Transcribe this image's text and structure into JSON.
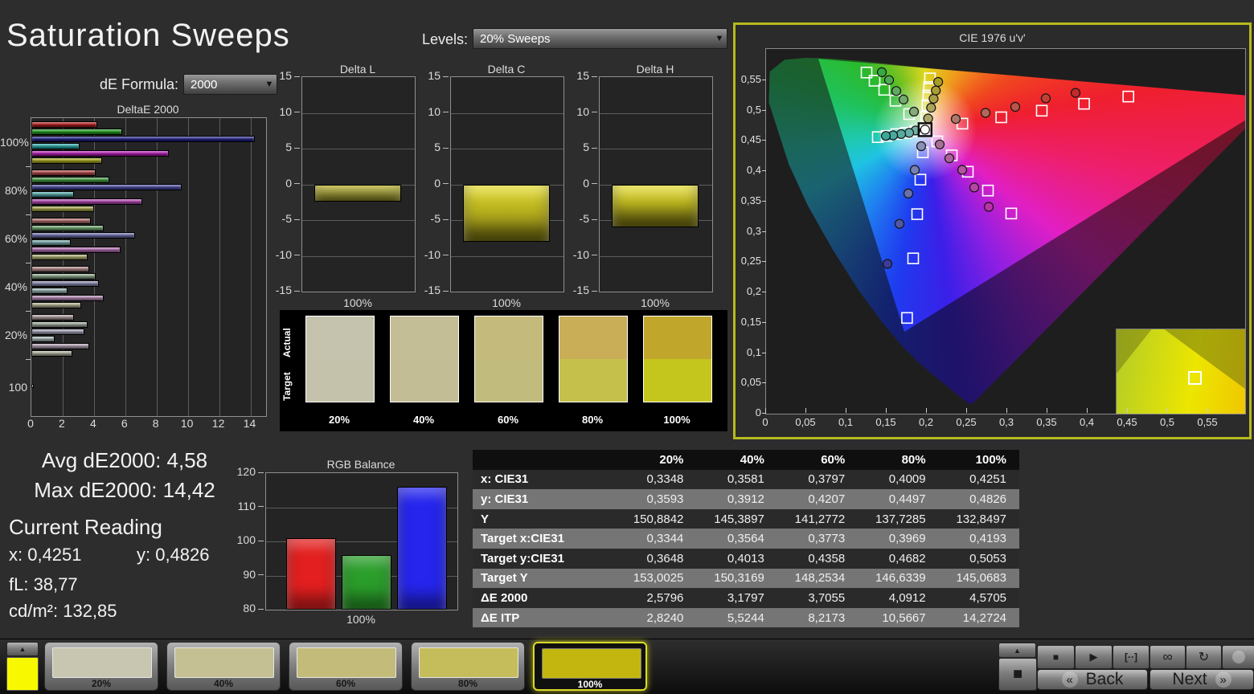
{
  "title": "Saturation Sweeps",
  "controls": {
    "de_formula_label": "dE Formula:",
    "de_formula_value": "2000",
    "levels_label": "Levels:",
    "levels_value": "20% Sweeps"
  },
  "readings": {
    "avg": "Avg dE2000: 4,58",
    "max": "Max dE2000: 14,42",
    "current_title": "Current Reading",
    "x": "x: 0,4251",
    "y": "y: 0,4826",
    "fl": "fL: 38,77",
    "cd": "cd/m²: 132,85"
  },
  "chart_data": [
    {
      "id": "deltae2000",
      "type": "bar",
      "orientation": "horizontal",
      "title": "DeltaE 2000",
      "xlim": [
        0,
        15
      ],
      "xticks": [
        0,
        2,
        4,
        6,
        8,
        10,
        12,
        14
      ],
      "groups": [
        {
          "label": "100%",
          "values": [
            4.2,
            5.8,
            14.3,
            3.1,
            8.8,
            4.5
          ]
        },
        {
          "label": "80%",
          "values": [
            4.1,
            5.0,
            9.6,
            2.7,
            7.1,
            4.0
          ]
        },
        {
          "label": "60%",
          "values": [
            3.8,
            4.6,
            6.6,
            2.5,
            5.7,
            3.6
          ]
        },
        {
          "label": "40%",
          "values": [
            3.7,
            4.1,
            4.3,
            2.3,
            4.6,
            3.2
          ]
        },
        {
          "label": "20%",
          "values": [
            2.7,
            3.6,
            3.4,
            1.5,
            3.7,
            2.6
          ]
        },
        {
          "label": "100",
          "values": [
            0.15
          ]
        }
      ],
      "group_colors": [
        [
          "#c01d1d",
          "#1ea41e",
          "#20208f",
          "#28b0b0",
          "#c01dc0",
          "#b0b01d"
        ],
        [
          "#bc4848",
          "#45a445",
          "#4b4ba6",
          "#55b0b0",
          "#bc48bc",
          "#aeae49"
        ],
        [
          "#b96f6f",
          "#6fa86f",
          "#7070b2",
          "#7cb4b4",
          "#b96fb9",
          "#b2b273"
        ],
        [
          "#b78b8b",
          "#8fae8f",
          "#9191b8",
          "#9cbaba",
          "#b78bb7",
          "#b6b695"
        ],
        [
          "#b4a2a2",
          "#a4b2a4",
          "#a8a8bd",
          "#aebfbf",
          "#b4a2b4",
          "#b9b9a8"
        ],
        [
          "#f2f2f2"
        ]
      ]
    },
    {
      "id": "delta_l",
      "type": "bar",
      "title": "Delta L",
      "categories": [
        "100%"
      ],
      "values": [
        -2.4
      ],
      "ylim": [
        -15,
        15
      ],
      "yticks": [
        15,
        10,
        5,
        0,
        -5,
        -10,
        -15
      ],
      "bar_color": "#cfc826"
    },
    {
      "id": "delta_c",
      "type": "bar",
      "title": "Delta C",
      "categories": [
        "100%"
      ],
      "values": [
        -8.0
      ],
      "ylim": [
        -15,
        15
      ],
      "yticks": [
        15,
        10,
        5,
        0,
        -5,
        -10,
        -15
      ],
      "bar_color": "#cfc826"
    },
    {
      "id": "delta_h",
      "type": "bar",
      "title": "Delta H",
      "categories": [
        "100%"
      ],
      "values": [
        -6.0
      ],
      "ylim": [
        -15,
        15
      ],
      "yticks": [
        15,
        10,
        5,
        0,
        -5,
        -10,
        -15
      ],
      "bar_color": "#cfc826"
    },
    {
      "id": "rgb_balance",
      "type": "bar",
      "title": "RGB Balance",
      "categories": [
        "100%"
      ],
      "ylim": [
        80,
        120
      ],
      "yticks": [
        120,
        110,
        100,
        90,
        80
      ],
      "series": [
        {
          "name": "Red",
          "value": 101,
          "color": "#e31f1f"
        },
        {
          "name": "Green",
          "value": 96,
          "color": "#2a9e2a"
        },
        {
          "name": "Blue",
          "value": 116,
          "color": "#2525ee"
        }
      ]
    },
    {
      "id": "cie",
      "type": "scatter",
      "title": "CIE 1976 u'v'",
      "xlim": [
        0,
        0.596
      ],
      "ylim": [
        0,
        0.601
      ],
      "x_ticks": [
        "0",
        "0,05",
        "0,1",
        "0,15",
        "0,2",
        "0,25",
        "0,3",
        "0,35",
        "0,4",
        "0,45",
        "0,5",
        "0,55"
      ],
      "y_ticks": [
        "0,55",
        "0,5",
        "0,45",
        "0,4",
        "0,35",
        "0,3",
        "0,25",
        "0,2",
        "0,15",
        "0,1",
        "0,05",
        "0"
      ],
      "white_point": {
        "target": [
          0.1978,
          0.4683
        ],
        "measured": [
          0.1978,
          0.4683
        ]
      },
      "series": [
        {
          "name": "red",
          "targets": [
            [
              0.2442,
              0.4783
            ],
            [
              0.2926,
              0.4888
            ],
            [
              0.343,
              0.4996
            ],
            [
              0.3956,
              0.511
            ],
            [
              0.4507,
              0.5229
            ]
          ],
          "measured": [
            [
              0.236,
              0.486
            ],
            [
              0.273,
              0.496
            ],
            [
              0.31,
              0.506
            ],
            [
              0.348,
              0.52
            ],
            [
              0.385,
              0.529
            ]
          ],
          "dot_colors": [
            "#b07868",
            "#b46658",
            "#ba5448",
            "#c04038",
            "#c22a2a"
          ]
        },
        {
          "name": "green",
          "targets": [
            [
              0.178,
              0.494
            ],
            [
              0.161,
              0.516
            ],
            [
              0.147,
              0.534
            ],
            [
              0.135,
              0.549
            ],
            [
              0.125,
              0.5625
            ]
          ],
          "measured": [
            [
              0.184,
              0.498
            ],
            [
              0.171,
              0.518
            ],
            [
              0.162,
              0.532
            ],
            [
              0.153,
              0.55
            ],
            [
              0.144,
              0.563
            ]
          ],
          "dot_colors": [
            "#86aa7c",
            "#74aa6e",
            "#62aa60",
            "#50aa52",
            "#3aa843"
          ]
        },
        {
          "name": "blue",
          "targets": [
            [
              0.195,
              0.431
            ],
            [
              0.192,
              0.386
            ],
            [
              0.188,
              0.329
            ],
            [
              0.183,
              0.256
            ],
            [
              0.1754,
              0.1579
            ]
          ],
          "measured": [
            [
              0.193,
              0.441
            ],
            [
              0.185,
              0.402
            ],
            [
              0.177,
              0.363
            ],
            [
              0.166,
              0.313
            ],
            [
              0.151,
              0.247
            ]
          ],
          "dot_colors": [
            "#8890b4",
            "#7880b0",
            "#6870ac",
            "#5458a4",
            "#3a3c96"
          ]
        },
        {
          "name": "cyan",
          "targets": [
            [
              0.186,
              0.466
            ],
            [
              0.174,
              0.463
            ],
            [
              0.162,
              0.461
            ],
            [
              0.15,
              0.458
            ],
            [
              0.139,
              0.456
            ]
          ],
          "measured": [
            [
              0.186,
              0.467
            ],
            [
              0.178,
              0.463
            ],
            [
              0.168,
              0.461
            ],
            [
              0.158,
              0.459
            ],
            [
              0.149,
              0.458
            ]
          ],
          "dot_colors": [
            "#74b0a8",
            "#64aea6",
            "#54aca2",
            "#46aa9e",
            "#38a89a"
          ]
        },
        {
          "name": "magenta",
          "targets": [
            [
              0.213,
              0.449
            ],
            [
              0.231,
              0.426
            ],
            [
              0.251,
              0.399
            ],
            [
              0.276,
              0.368
            ],
            [
              0.305,
              0.33
            ]
          ],
          "measured": [
            [
              0.216,
              0.444
            ],
            [
              0.228,
              0.421
            ],
            [
              0.244,
              0.402
            ],
            [
              0.259,
              0.373
            ],
            [
              0.277,
              0.341
            ]
          ],
          "dot_colors": [
            "#aa7098",
            "#ae629c",
            "#b254a0",
            "#b646a4",
            "#bc32a8"
          ]
        },
        {
          "name": "yellow",
          "targets": [
            [
              0.1994,
              0.4894
            ],
            [
              0.2007,
              0.5085
            ],
            [
              0.2019,
              0.5247
            ],
            [
              0.2029,
              0.5385
            ],
            [
              0.2039,
              0.5529
            ]
          ],
          "measured": [
            [
              0.2016,
              0.4868
            ],
            [
              0.2053,
              0.5045
            ],
            [
              0.2084,
              0.5194
            ],
            [
              0.2112,
              0.5329
            ],
            [
              0.2141,
              0.547
            ]
          ],
          "dot_colors": [
            "#aca86a",
            "#aca458",
            "#aca046",
            "#ac9c34",
            "#aa9e22"
          ]
        }
      ],
      "locus": [
        [
          0.6234,
          0.5065
        ],
        [
          0.5203,
          0.5219
        ],
        [
          0.4692,
          0.5296
        ],
        [
          0.4035,
          0.5393
        ],
        [
          0.3316,
          0.5501
        ],
        [
          0.2623,
          0.5604
        ],
        [
          0.2026,
          0.5694
        ],
        [
          0.1531,
          0.5766
        ],
        [
          0.1127,
          0.5821
        ],
        [
          0.0792,
          0.5856
        ],
        [
          0.05,
          0.5868
        ],
        [
          0.0231,
          0.5836
        ],
        [
          0.0046,
          0.5639
        ],
        [
          0.0035,
          0.5131
        ],
        [
          0.0282,
          0.4117
        ],
        [
          0.0521,
          0.3427
        ],
        [
          0.0828,
          0.2708
        ],
        [
          0.1147,
          0.2044
        ],
        [
          0.1441,
          0.151
        ],
        [
          0.169,
          0.112
        ],
        [
          0.1877,
          0.0871
        ],
        [
          0.2033,
          0.0688
        ],
        [
          0.2347,
          0.035
        ],
        [
          0.2522,
          0.0169
        ],
        [
          0.2569,
          0.0165
        ]
      ],
      "gamut_triangle": [
        [
          0.065,
          0.585
        ],
        [
          0.64,
          0.52
        ],
        [
          0.172,
          0.135
        ]
      ],
      "wheel": [
        [
          "0deg",
          "#ded71f"
        ],
        [
          "28deg",
          "#ef9c1c"
        ],
        [
          "58deg",
          "#f0491f"
        ],
        [
          "80deg",
          "#ef1f2e"
        ],
        [
          "100deg",
          "#ee1f66"
        ],
        [
          "128deg",
          "#e11fc4"
        ],
        [
          "152deg",
          "#8d1fe2"
        ],
        [
          "172deg",
          "#3b1fe8"
        ],
        [
          "190deg",
          "#1f3bef"
        ],
        [
          "215deg",
          "#1f83ef"
        ],
        [
          "242deg",
          "#1fc3e2"
        ],
        [
          "262deg",
          "#1fc9b0"
        ],
        [
          "288deg",
          "#1fc25e"
        ],
        [
          "315deg",
          "#2bb92b"
        ],
        [
          "338deg",
          "#85c41f"
        ],
        [
          "360deg",
          "#ded71f"
        ]
      ],
      "inset": {
        "square_pos": [
          0.45,
          0.4
        ],
        "dot_pos": [
          0.57,
          0.84
        ],
        "dot_color": "#b8ac10",
        "bg_left": "#b2cc28",
        "bg_mid": "#ece600",
        "bg_right": "#f2b400",
        "shade": "#6f7410"
      }
    }
  ],
  "swatch_panel": {
    "row_labels": [
      "Actual",
      "Target"
    ],
    "levels": [
      "20%",
      "40%",
      "60%",
      "80%",
      "100%"
    ],
    "actual_colors": [
      "#c5c3ad",
      "#c4be97",
      "#c4ba7b",
      "#c9ae57",
      "#c0a72c"
    ],
    "target_colors": [
      "#c4c2aa",
      "#c2bd95",
      "#c1bc7e",
      "#c5c04c",
      "#c5c61d"
    ]
  },
  "table": {
    "columns": [
      "20%",
      "40%",
      "60%",
      "80%",
      "100%"
    ],
    "rows": [
      {
        "label": "x: CIE31",
        "values": [
          "0,3348",
          "0,3581",
          "0,3797",
          "0,4009",
          "0,4251"
        ]
      },
      {
        "label": "y: CIE31",
        "values": [
          "0,3593",
          "0,3912",
          "0,4207",
          "0,4497",
          "0,4826"
        ]
      },
      {
        "label": "Y",
        "values": [
          "150,8842",
          "145,3897",
          "141,2772",
          "137,7285",
          "132,8497"
        ]
      },
      {
        "label": "Target x:CIE31",
        "values": [
          "0,3344",
          "0,3564",
          "0,3773",
          "0,3969",
          "0,4193"
        ]
      },
      {
        "label": "Target y:CIE31",
        "values": [
          "0,3648",
          "0,4013",
          "0,4358",
          "0,4682",
          "0,5053"
        ]
      },
      {
        "label": "Target Y",
        "values": [
          "153,0025",
          "150,3169",
          "148,2534",
          "146,6339",
          "145,0683"
        ]
      },
      {
        "label": "ΔE 2000",
        "values": [
          "2,5796",
          "3,1797",
          "3,7055",
          "4,0912",
          "4,5705"
        ]
      },
      {
        "label": "ΔE ITP",
        "values": [
          "2,8240",
          "5,5244",
          "8,2173",
          "10,5667",
          "14,2724"
        ]
      }
    ]
  },
  "bottom_bar": {
    "scroll_up_icon": "▲",
    "active_swatch_color": "#f8f800",
    "patches": [
      {
        "label": "20%",
        "color": "#c8c6b0",
        "selected": false
      },
      {
        "label": "40%",
        "color": "#c5c094",
        "selected": false
      },
      {
        "label": "60%",
        "color": "#c3bb79",
        "selected": false
      },
      {
        "label": "80%",
        "color": "#c5bd5b",
        "selected": false
      },
      {
        "label": "100%",
        "color": "#c3b70f",
        "selected": true
      }
    ],
    "transport": {
      "up_icon": "▲",
      "stop_big_icon": "■",
      "stop_icon": "■",
      "play_icon": "▶",
      "measure_icon": "[··]",
      "continuous_icon": "∞",
      "refresh_icon": "↻",
      "back_label": "Back",
      "next_label": "Next",
      "back_icon": "«",
      "next_icon": "»"
    }
  }
}
